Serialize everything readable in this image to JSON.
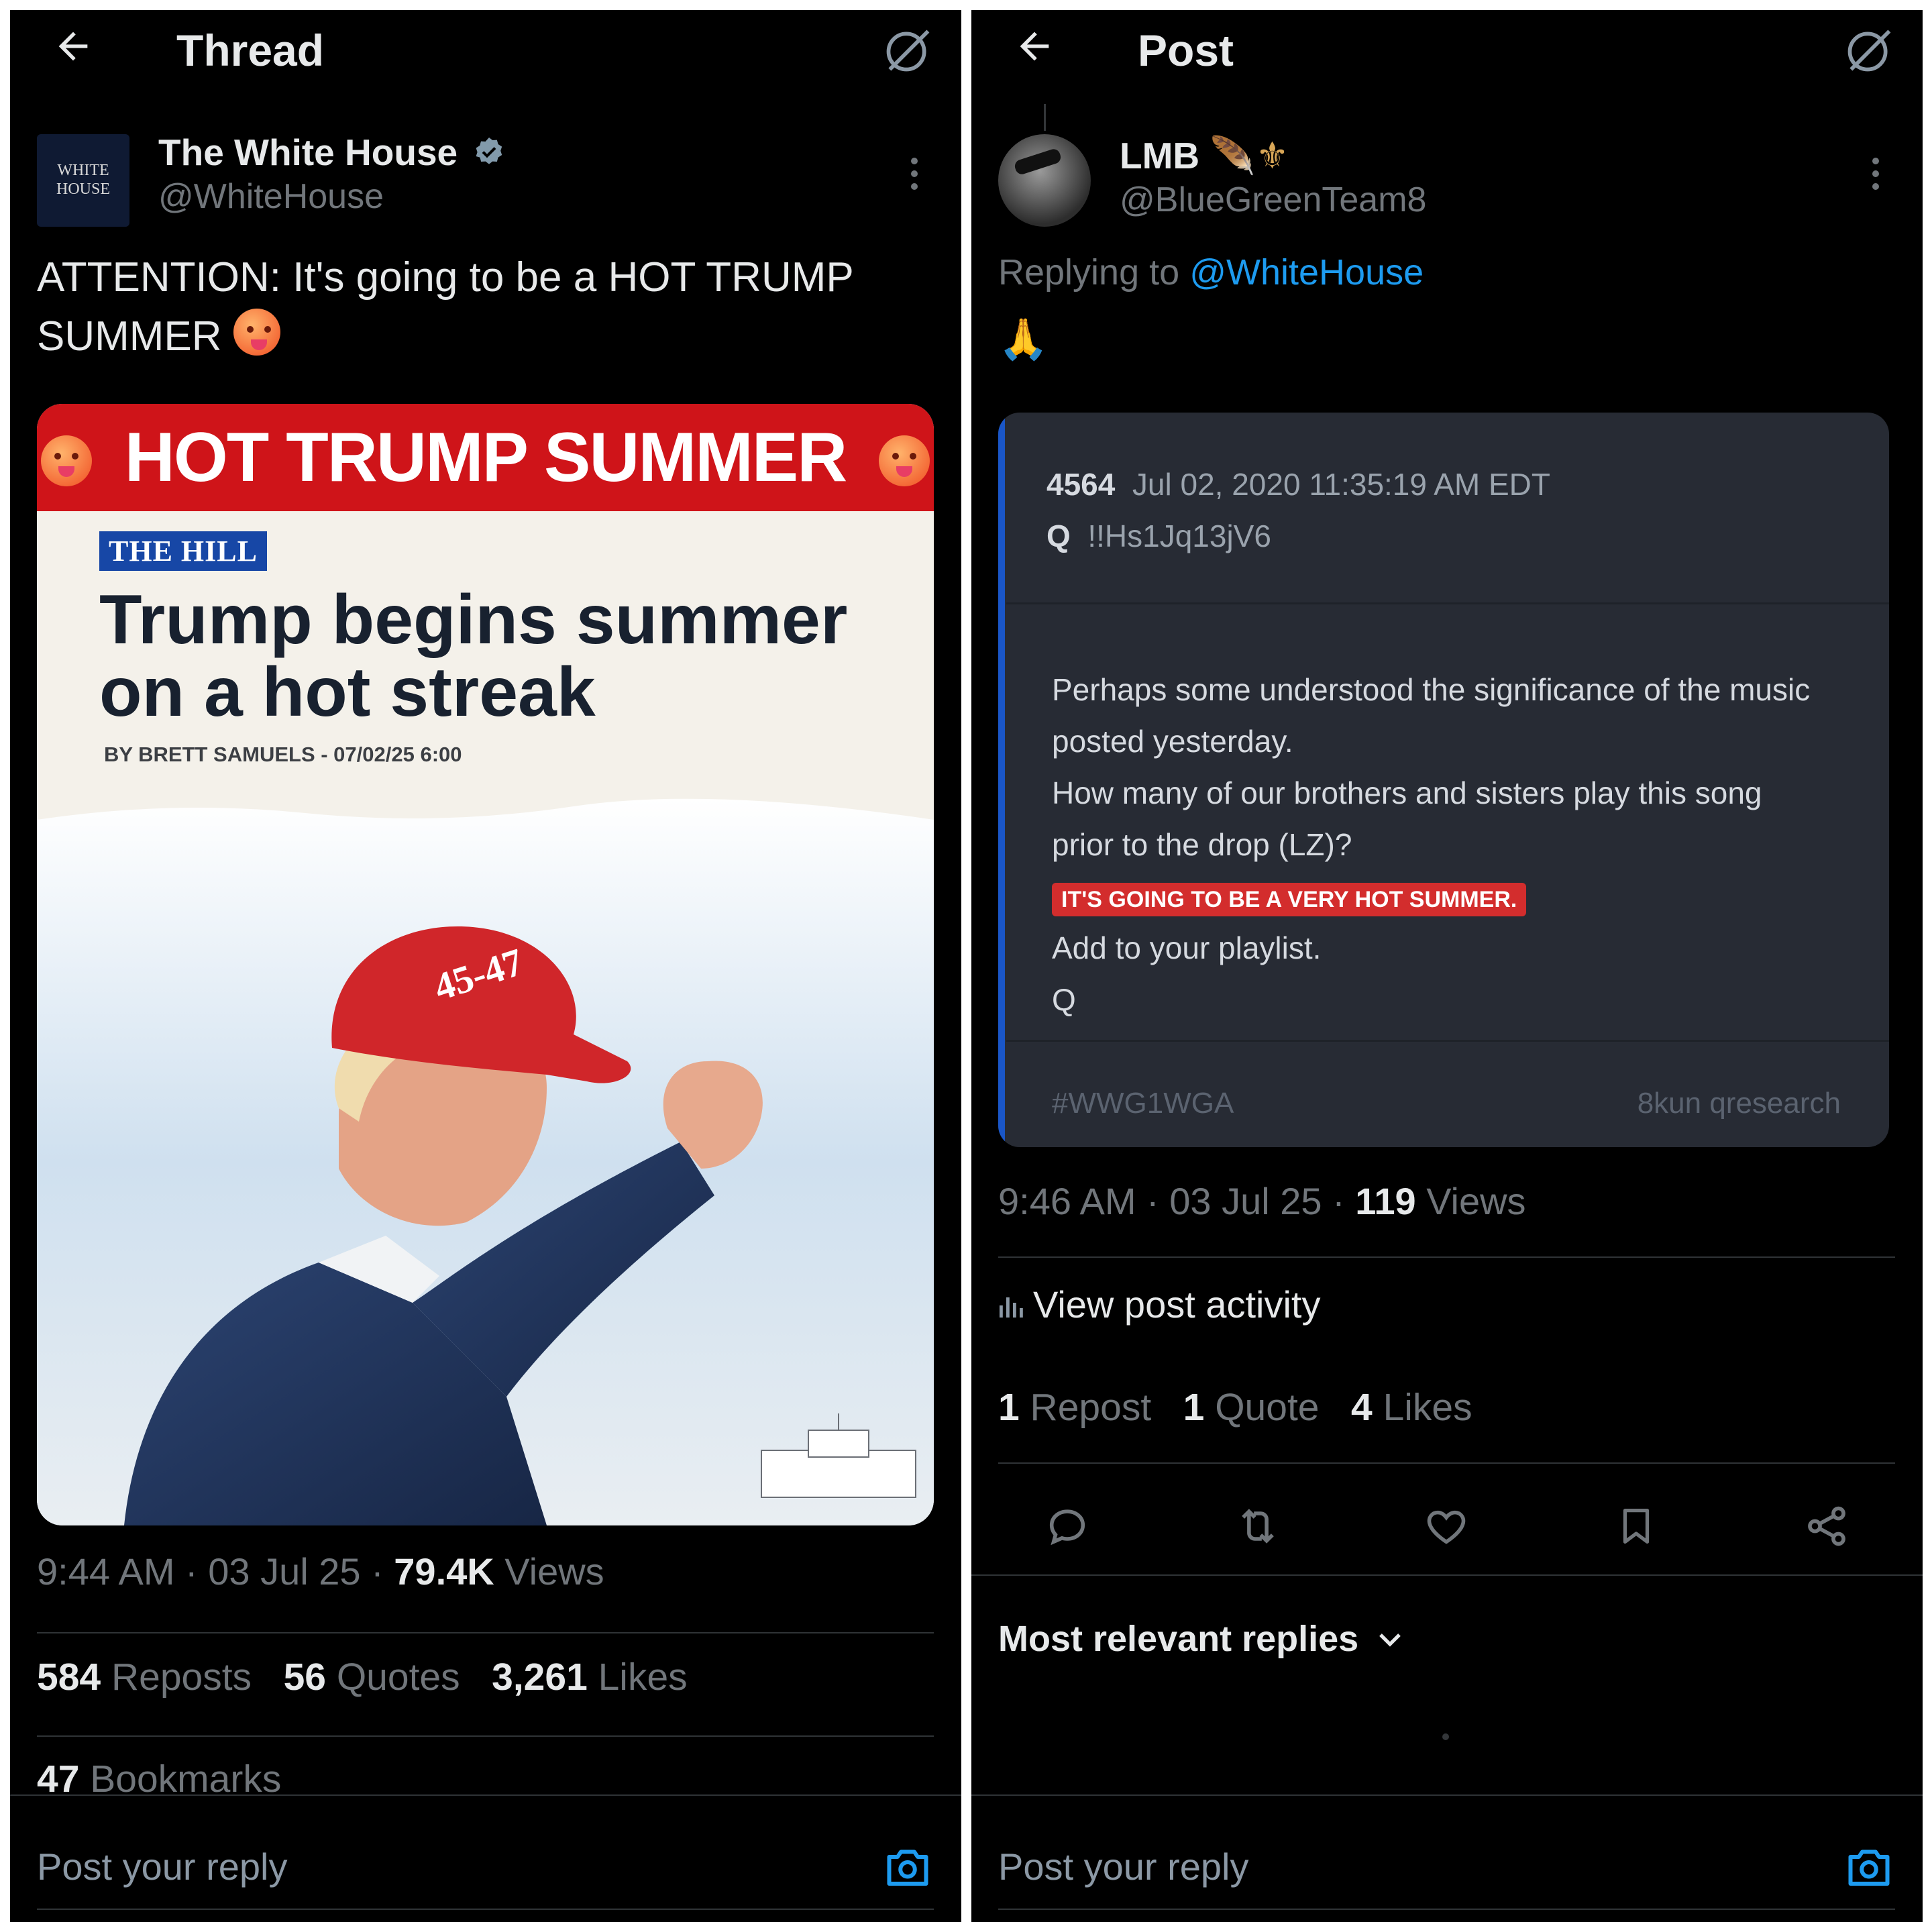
{
  "left": {
    "topbar": {
      "title": "Thread"
    },
    "author": {
      "avatar_text": "WHITE HOUSE",
      "name": "The White House",
      "handle": "@WhiteHouse"
    },
    "tweet_text": "ATTENTION: It's going to be a HOT TRUMP SUMMER",
    "media": {
      "banner": "HOT TRUMP SUMMER",
      "outlet": "THE HILL",
      "headline": "Trump begins summer on a hot streak",
      "byline": "BY BRETT SAMUELS - 07/02/25 6:00",
      "cap_text": "45-47"
    },
    "meta": {
      "time": "9:44 AM",
      "date": "03 Jul 25",
      "views_count": "79.4K",
      "views_label": "Views"
    },
    "stats": {
      "reposts_count": "584",
      "reposts_label": "Reposts",
      "quotes_count": "56",
      "quotes_label": "Quotes",
      "likes_count": "3,261",
      "likes_label": "Likes",
      "bookmarks_count": "47",
      "bookmarks_label": "Bookmarks"
    },
    "reply_placeholder": "Post your reply"
  },
  "right": {
    "topbar": {
      "title": "Post"
    },
    "author": {
      "name": "LMB",
      "name_emoji": "🪶⚜",
      "handle": "@BlueGreenTeam8"
    },
    "replying_prefix": "Replying to",
    "replying_handle": "@WhiteHouse",
    "post_emoji": "🙏",
    "qcard": {
      "post_number": "4564",
      "timestamp": "Jul 02, 2020 11:35:19 AM EDT",
      "poster": "Q",
      "tripcode": "!!Hs1Jq13jV6",
      "line1": "Perhaps some understood the significance of the music",
      "line2": "posted yesterday.",
      "line3": "How many of our brothers and sisters play this song",
      "line4": "prior to the drop (LZ)?",
      "highlight": "IT'S GOING TO BE A VERY HOT SUMMER.",
      "line5": "Add to your playlist.",
      "line6": "Q",
      "hashtag": "#WWG1WGA",
      "source": "8kun qresearch"
    },
    "meta": {
      "time": "9:46 AM",
      "date": "03 Jul 25",
      "views_count": "119",
      "views_label": "Views"
    },
    "activity_label": "View post activity",
    "stats": {
      "reposts_count": "1",
      "reposts_label": "Repost",
      "quotes_count": "1",
      "quotes_label": "Quote",
      "likes_count": "4",
      "likes_label": "Likes"
    },
    "replies_sort": "Most relevant replies",
    "reply_placeholder": "Post your reply"
  },
  "colors": {
    "background": "#000000",
    "accent": "#1d9bf0",
    "muted": "#71767b",
    "banner_red": "#cf1419"
  },
  "icons": [
    "back-arrow-icon",
    "grok-icon",
    "verified-badge-icon",
    "more-icon",
    "camera-icon",
    "reply-icon",
    "repost-icon",
    "like-icon",
    "bookmark-icon",
    "share-icon",
    "analytics-icon",
    "chevron-down-icon"
  ]
}
